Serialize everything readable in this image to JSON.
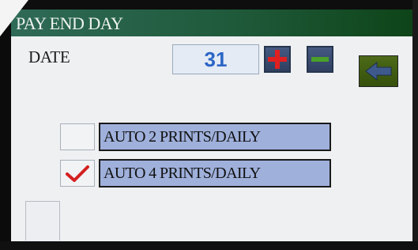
{
  "screen": {
    "title": "PAY END DAY"
  },
  "date_row": {
    "label": "DATE",
    "value": "31",
    "increment_icon": "plus-icon",
    "decrement_icon": "minus-icon",
    "back_icon": "back-arrow-icon"
  },
  "options": [
    {
      "label": "AUTO 2 PRINTS/DAILY",
      "checked": false
    },
    {
      "label": "AUTO 4 PRINTS/DAILY",
      "checked": true
    }
  ],
  "colors": {
    "title_bar": "#1f5a3b",
    "option_bg": "#9fb0db",
    "value_text": "#2c66c6",
    "plus_sign": "#e02020",
    "minus_sign": "#4aa02a",
    "checkmark": "#d42020",
    "back_button": "#4c6a18",
    "back_arrow": "#3e5a8c"
  }
}
